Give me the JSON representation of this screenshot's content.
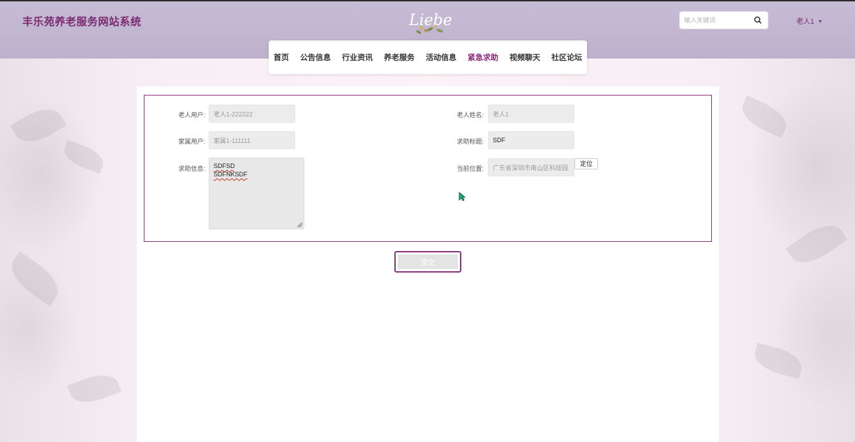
{
  "header": {
    "site_title": "丰乐苑养老服务网站系统",
    "logo_text": "Liebe",
    "search_placeholder": "输入关键词",
    "user_label": "老人1"
  },
  "nav": {
    "items": [
      {
        "label": "首页",
        "active": false
      },
      {
        "label": "公告信息",
        "active": false
      },
      {
        "label": "行业资讯",
        "active": false
      },
      {
        "label": "养老服务",
        "active": false
      },
      {
        "label": "活动信息",
        "active": false
      },
      {
        "label": "紧急求助",
        "active": true
      },
      {
        "label": "视频聊天",
        "active": false
      },
      {
        "label": "社区论坛",
        "active": false
      }
    ]
  },
  "form": {
    "elder_user": {
      "label": "老人用户:",
      "value": "老人1-222222"
    },
    "elder_name": {
      "label": "老人姓名:",
      "value": "老人1"
    },
    "family_user": {
      "label": "家属用户:",
      "value": "家属1-111111"
    },
    "help_title": {
      "label": "求助标题:",
      "value": "SDF"
    },
    "help_info": {
      "label": "求助信息:",
      "lines": [
        "SDFSD",
        "SDFNKSDF"
      ]
    },
    "location": {
      "label": "当前位置:",
      "value": "广东省深圳市南山区科技园",
      "locate_label": "定位"
    },
    "submit_label": "提交"
  },
  "colors": {
    "brand": "#7a2a70",
    "active_nav": "#8a2a7e",
    "header_bg": "#c2b7d1",
    "form_border": "#8a3a80"
  }
}
